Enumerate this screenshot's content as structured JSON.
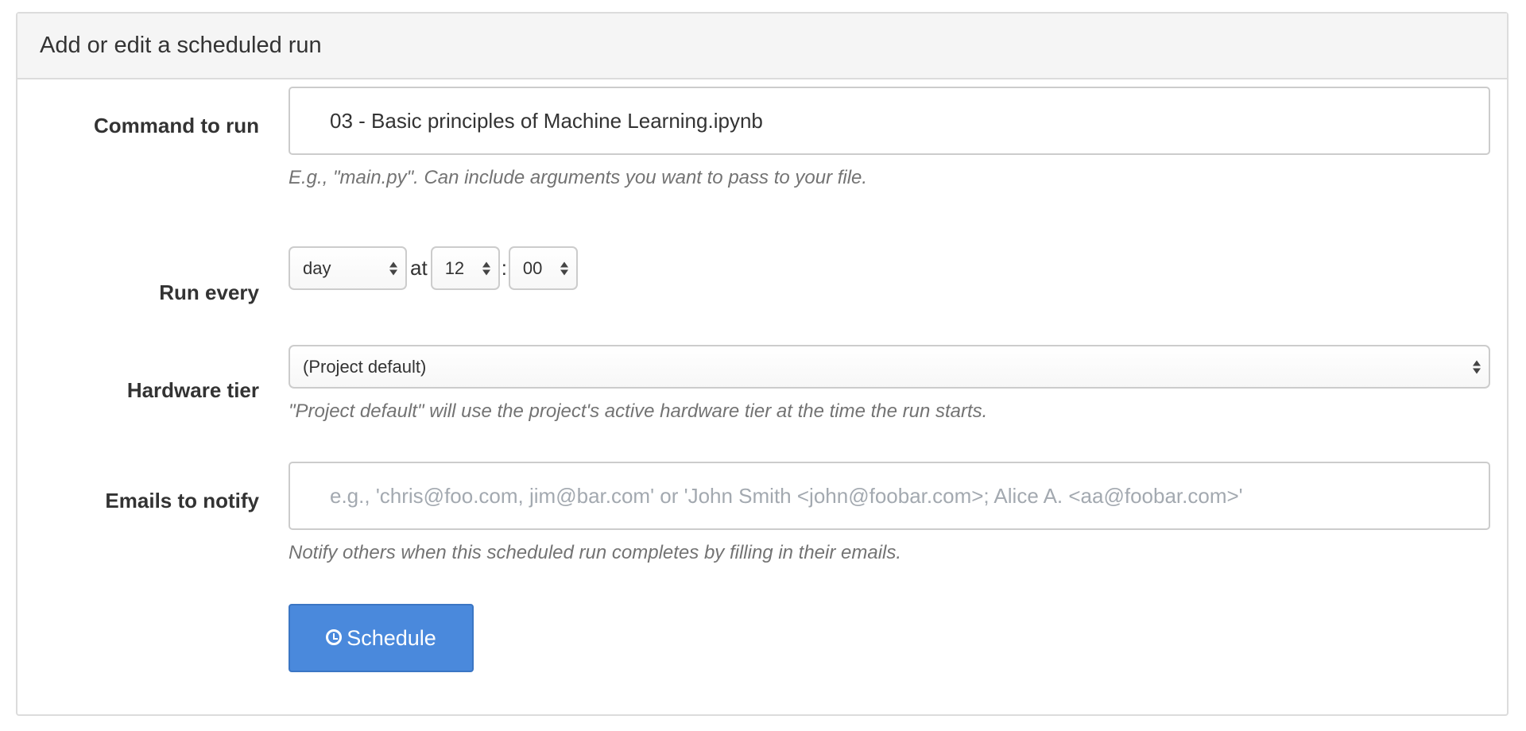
{
  "panel": {
    "title": "Add or edit a scheduled run"
  },
  "command": {
    "label": "Command to run",
    "value": "03 - Basic principles of Machine Learning.ipynb",
    "help": "E.g., \"main.py\". Can include arguments you want to pass to your file."
  },
  "run_every": {
    "label": "Run every",
    "period_value": "day",
    "at_text": "at",
    "hour_value": "12",
    "colon": ":",
    "minute_value": "00"
  },
  "hardware": {
    "label": "Hardware tier",
    "value": "(Project default)",
    "help": "\"Project default\" will use the project's active hardware tier at the time the run starts."
  },
  "emails": {
    "label": "Emails to notify",
    "placeholder": "e.g., 'chris@foo.com, jim@bar.com' or 'John Smith <john@foobar.com>; Alice A. <aa@foobar.com>'",
    "help": "Notify others when this scheduled run completes by filling in their emails."
  },
  "actions": {
    "schedule_label": "Schedule",
    "schedule_icon": "clock-icon",
    "button_color": "#4a89dc"
  }
}
